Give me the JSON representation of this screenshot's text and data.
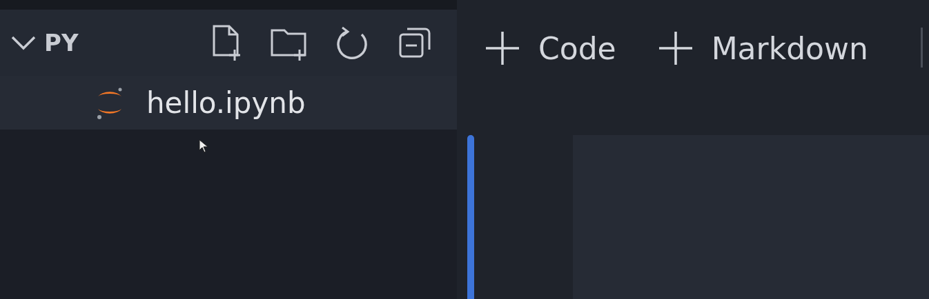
{
  "explorer": {
    "section": {
      "label": "PY",
      "expanded": true
    },
    "files": [
      {
        "name": "hello.ipynb",
        "selected": true
      }
    ]
  },
  "notebook_toolbar": {
    "buttons": [
      {
        "label": "Code"
      },
      {
        "label": "Markdown"
      }
    ]
  },
  "cell": {
    "focused": true
  }
}
